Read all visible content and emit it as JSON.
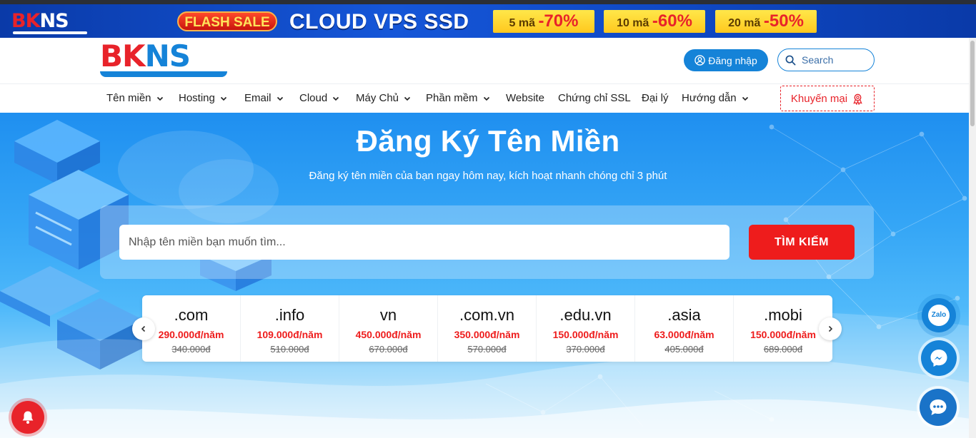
{
  "promo_banner": {
    "logo": "BKNS",
    "flash_label": "FLASH SALE",
    "headline": "CLOUD VPS SSD",
    "coupons": [
      {
        "label": "5 mã",
        "discount": "-70%"
      },
      {
        "label": "10 mã",
        "discount": "-60%"
      },
      {
        "label": "20 mã",
        "discount": "-50%"
      }
    ]
  },
  "header": {
    "logo": "BKNS",
    "login_label": "Đăng nhập",
    "search_placeholder": "Search"
  },
  "nav": {
    "items": [
      {
        "label": "Tên miền",
        "dropdown": true
      },
      {
        "label": "Hosting",
        "dropdown": true
      },
      {
        "label": "Email",
        "dropdown": true
      },
      {
        "label": "Cloud",
        "dropdown": true
      },
      {
        "label": "Máy Chủ",
        "dropdown": true
      },
      {
        "label": "Phần mềm",
        "dropdown": true
      },
      {
        "label": "Website",
        "dropdown": false
      },
      {
        "label": "Chứng chỉ SSL",
        "dropdown": false
      },
      {
        "label": "Đại lý",
        "dropdown": false
      },
      {
        "label": "Hướng dẫn",
        "dropdown": true
      }
    ],
    "promo_label": "Khuyến mại"
  },
  "hero": {
    "title": "Đăng Ký Tên Miền",
    "subtitle": "Đăng ký tên miền của bạn ngay hôm nay, kích hoạt nhanh chóng chỉ 3 phút",
    "input_placeholder": "Nhập tên miền bạn muốn tìm...",
    "search_button": "TÌM KIẾM"
  },
  "domains": [
    {
      "tld": ".com",
      "price": "290.000đ/năm",
      "old_price": "340.000đ"
    },
    {
      "tld": ".info",
      "price": "109.000đ/năm",
      "old_price": "510.000đ"
    },
    {
      "tld": "vn",
      "price": "450.000đ/năm",
      "old_price": "670.000đ"
    },
    {
      "tld": ".com.vn",
      "price": "350.000đ/năm",
      "old_price": "570.000đ"
    },
    {
      "tld": ".edu.vn",
      "price": "150.000đ/năm",
      "old_price": "370.000đ"
    },
    {
      "tld": ".asia",
      "price": "63.000đ/năm",
      "old_price": "405.000đ"
    },
    {
      "tld": ".mobi",
      "price": "150.000đ/năm",
      "old_price": "689.000đ"
    }
  ],
  "widgets": {
    "zalo_label": "Zalo"
  },
  "colors": {
    "brand_red": "#e8232a",
    "brand_blue": "#1583d8",
    "cta_red": "#ee1c1c"
  }
}
